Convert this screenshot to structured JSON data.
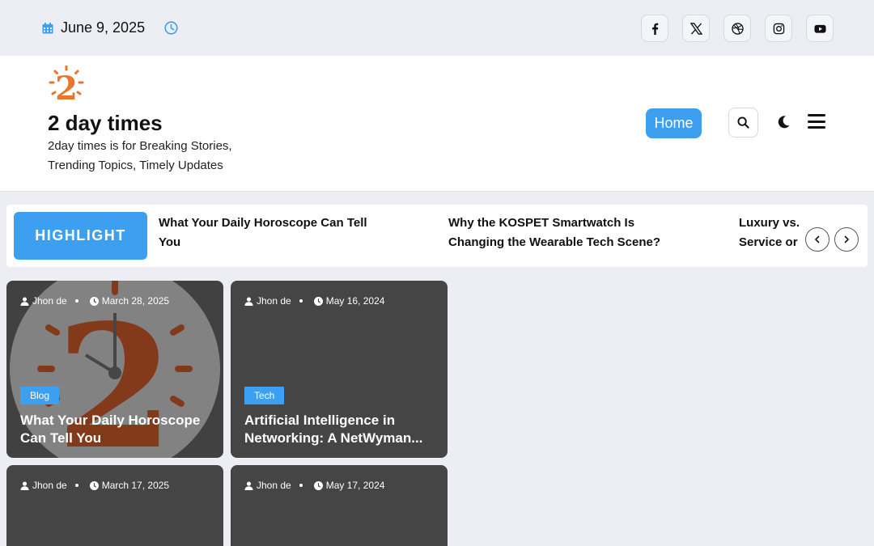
{
  "topbar": {
    "date": "June 9, 2025",
    "icons": [
      "calendar-icon",
      "clock-icon"
    ],
    "socials": [
      "facebook-icon",
      "x-icon",
      "dribbble-icon",
      "instagram-icon",
      "youtube-icon"
    ]
  },
  "header": {
    "logo_text": "2",
    "site_title": "2 day times",
    "tagline": "2day times is for Breaking Stories, Trending Topics, Timely Updates",
    "nav_home": "Home"
  },
  "highlight": {
    "label": "HIGHLIGHT",
    "items": [
      "What Your Daily Horoscope Can Tell You",
      "Why the KOSPET Smartwatch Is Changing the Wearable Tech Scene?",
      "Luxury vs. Service or"
    ]
  },
  "posts": [
    {
      "author": "Jhon de",
      "date": "March 28, 2025",
      "category": "Blog",
      "title_line1": "What Your Daily Horoscope",
      "title_line2": "Can Tell You"
    },
    {
      "author": "Jhon de",
      "date": "May 16, 2024",
      "category": "Tech",
      "title_line1": "Artificial Intelligence in",
      "title_line2": "Networking: A NetWyman..."
    },
    {
      "author": "Jhon de",
      "date": "March 17, 2025"
    },
    {
      "author": "Jhon de",
      "date": "May 17, 2024"
    }
  ],
  "colors": {
    "accent": "#3d9ff0",
    "logo_orange": "#e8772e",
    "card_bg": "#454545",
    "page_bg": "#eceef3"
  }
}
